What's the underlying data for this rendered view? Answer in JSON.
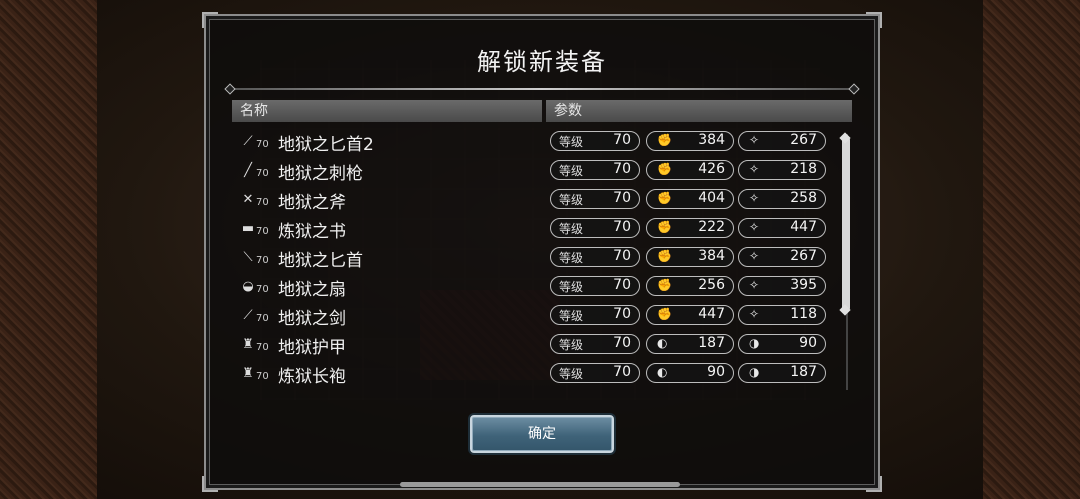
{
  "dialog": {
    "title": "解锁新装备",
    "header_name": "名称",
    "header_params": "参数",
    "confirm_label": "确定"
  },
  "items": [
    {
      "icon": "dagger-icon",
      "glyph": "⟋",
      "level": "70",
      "name": "地狱之匕首2",
      "lv_label": "等级",
      "lv_value": "70",
      "stat_a_icon": "phys-attack-icon",
      "stat_a": "384",
      "stat_b_icon": "elem-attack-icon",
      "stat_b": "267"
    },
    {
      "icon": "spear-icon",
      "glyph": "╱",
      "level": "70",
      "name": "地狱之刺枪",
      "lv_label": "等级",
      "lv_value": "70",
      "stat_a_icon": "phys-attack-icon",
      "stat_a": "426",
      "stat_b_icon": "elem-attack-icon",
      "stat_b": "218"
    },
    {
      "icon": "axe-icon",
      "glyph": "✕",
      "level": "70",
      "name": "地狱之斧",
      "lv_label": "等级",
      "lv_value": "70",
      "stat_a_icon": "phys-attack-icon",
      "stat_a": "404",
      "stat_b_icon": "elem-attack-icon",
      "stat_b": "258"
    },
    {
      "icon": "tome-icon",
      "glyph": "▬",
      "level": "70",
      "name": "炼狱之书",
      "lv_label": "等级",
      "lv_value": "70",
      "stat_a_icon": "phys-attack-icon",
      "stat_a": "222",
      "stat_b_icon": "elem-attack-icon",
      "stat_b": "447"
    },
    {
      "icon": "dagger-icon",
      "glyph": "⟍",
      "level": "70",
      "name": "地狱之匕首",
      "lv_label": "等级",
      "lv_value": "70",
      "stat_a_icon": "phys-attack-icon",
      "stat_a": "384",
      "stat_b_icon": "elem-attack-icon",
      "stat_b": "267"
    },
    {
      "icon": "fan-icon",
      "glyph": "◒",
      "level": "70",
      "name": "地狱之扇",
      "lv_label": "等级",
      "lv_value": "70",
      "stat_a_icon": "phys-attack-icon",
      "stat_a": "256",
      "stat_b_icon": "elem-attack-icon",
      "stat_b": "395"
    },
    {
      "icon": "sword-icon",
      "glyph": "⟋",
      "level": "70",
      "name": "地狱之剑",
      "lv_label": "等级",
      "lv_value": "70",
      "stat_a_icon": "phys-attack-icon",
      "stat_a": "447",
      "stat_b_icon": "elem-attack-icon",
      "stat_b": "118"
    },
    {
      "icon": "armor-icon",
      "glyph": "♜",
      "level": "70",
      "name": "地狱护甲",
      "lv_label": "等级",
      "lv_value": "70",
      "stat_a_icon": "phys-defense-icon",
      "stat_a": "187",
      "stat_b_icon": "elem-defense-icon",
      "stat_b": "90"
    },
    {
      "icon": "robe-icon",
      "glyph": "♜",
      "level": "70",
      "name": "炼狱长袍",
      "lv_label": "等级",
      "lv_value": "70",
      "stat_a_icon": "phys-defense-icon",
      "stat_a": "90",
      "stat_b_icon": "elem-defense-icon",
      "stat_b": "187"
    }
  ]
}
